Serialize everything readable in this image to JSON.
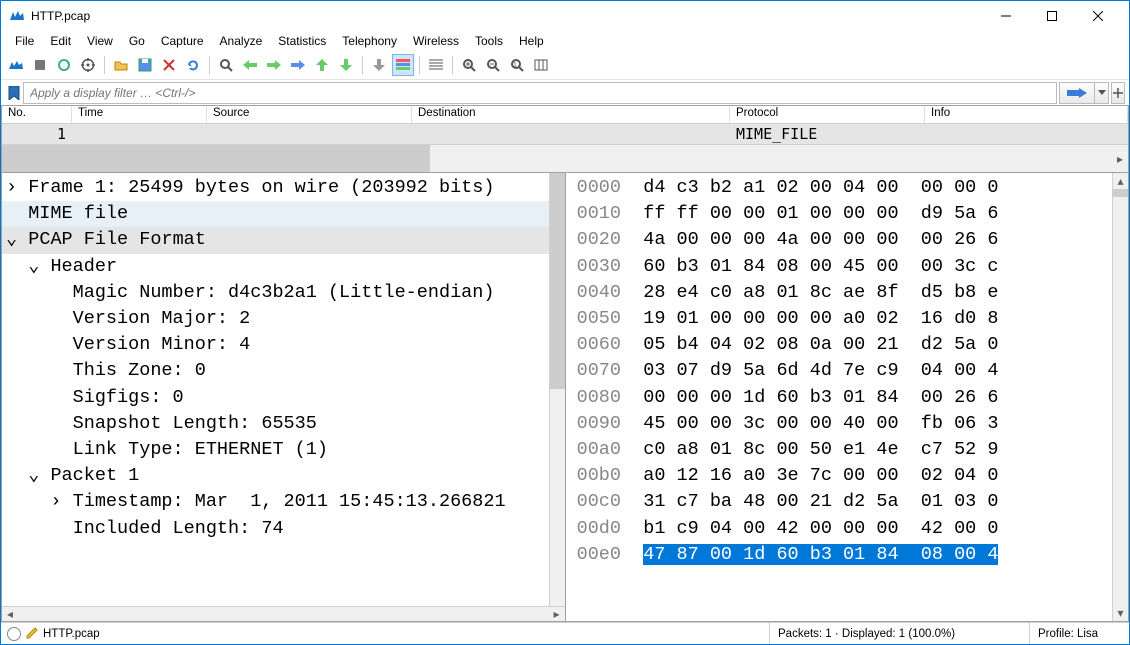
{
  "window": {
    "title": "HTTP.pcap"
  },
  "menu": [
    "File",
    "Edit",
    "View",
    "Go",
    "Capture",
    "Analyze",
    "Statistics",
    "Telephony",
    "Wireless",
    "Tools",
    "Help"
  ],
  "filter": {
    "placeholder": "Apply a display filter … <Ctrl-/>"
  },
  "packet_list": {
    "columns": [
      "No.",
      "Time",
      "Source",
      "Destination",
      "Protocol",
      "Info"
    ],
    "rows": [
      {
        "no": "1",
        "time": "",
        "source": "",
        "destination": "",
        "protocol": "MIME_FILE",
        "info": ""
      }
    ]
  },
  "tree": [
    {
      "indent": 0,
      "expander": "›",
      "text": "Frame 1: 25499 bytes on wire (203992 bits)",
      "hl": "none"
    },
    {
      "indent": 0,
      "expander": " ",
      "text": "MIME file",
      "hl": "sel1"
    },
    {
      "indent": 0,
      "expander": "⌄",
      "text": "PCAP File Format",
      "hl": "sel2"
    },
    {
      "indent": 1,
      "expander": "⌄",
      "text": "Header",
      "hl": "none"
    },
    {
      "indent": 2,
      "expander": " ",
      "text": "Magic Number: d4c3b2a1 (Little-endian)",
      "hl": "none"
    },
    {
      "indent": 2,
      "expander": " ",
      "text": "Version Major: 2",
      "hl": "none"
    },
    {
      "indent": 2,
      "expander": " ",
      "text": "Version Minor: 4",
      "hl": "none"
    },
    {
      "indent": 2,
      "expander": " ",
      "text": "This Zone: 0",
      "hl": "none"
    },
    {
      "indent": 2,
      "expander": " ",
      "text": "Sigfigs: 0",
      "hl": "none"
    },
    {
      "indent": 2,
      "expander": " ",
      "text": "Snapshot Length: 65535",
      "hl": "none"
    },
    {
      "indent": 2,
      "expander": " ",
      "text": "Link Type: ETHERNET (1)",
      "hl": "none"
    },
    {
      "indent": 1,
      "expander": "⌄",
      "text": "Packet 1",
      "hl": "none"
    },
    {
      "indent": 2,
      "expander": "›",
      "text": "Timestamp: Mar  1, 2011 15:45:13.266821",
      "hl": "none"
    },
    {
      "indent": 2,
      "expander": " ",
      "text": "Included Length: 74",
      "hl": "none"
    }
  ],
  "hex": [
    {
      "off": "0000",
      "b": "d4 c3 b2 a1 02 00 04 00  00 00 0",
      "sel": false
    },
    {
      "off": "0010",
      "b": "ff ff 00 00 01 00 00 00  d9 5a 6",
      "sel": false
    },
    {
      "off": "0020",
      "b": "4a 00 00 00 4a 00 00 00  00 26 6",
      "sel": false
    },
    {
      "off": "0030",
      "b": "60 b3 01 84 08 00 45 00  00 3c c",
      "sel": false
    },
    {
      "off": "0040",
      "b": "28 e4 c0 a8 01 8c ae 8f  d5 b8 e",
      "sel": false
    },
    {
      "off": "0050",
      "b": "19 01 00 00 00 00 a0 02  16 d0 8",
      "sel": false
    },
    {
      "off": "0060",
      "b": "05 b4 04 02 08 0a 00 21  d2 5a 0",
      "sel": false
    },
    {
      "off": "0070",
      "b": "03 07 d9 5a 6d 4d 7e c9  04 00 4",
      "sel": false
    },
    {
      "off": "0080",
      "b": "00 00 00 1d 60 b3 01 84  00 26 6",
      "sel": false
    },
    {
      "off": "0090",
      "b": "45 00 00 3c 00 00 40 00  fb 06 3",
      "sel": false
    },
    {
      "off": "00a0",
      "b": "c0 a8 01 8c 00 50 e1 4e  c7 52 9",
      "sel": false
    },
    {
      "off": "00b0",
      "b": "a0 12 16 a0 3e 7c 00 00  02 04 0",
      "sel": false
    },
    {
      "off": "00c0",
      "b": "31 c7 ba 48 00 21 d2 5a  01 03 0",
      "sel": false
    },
    {
      "off": "00d0",
      "b": "b1 c9 04 00 42 00 00 00  42 00 0",
      "sel": false
    },
    {
      "off": "00e0",
      "b": "47 87 00 1d 60 b3 01 84  08 00 4",
      "sel": true
    }
  ],
  "status": {
    "file": "HTTP.pcap",
    "packets": "Packets: 1 · Displayed: 1 (100.0%)",
    "profile": "Profile: Lisa"
  }
}
